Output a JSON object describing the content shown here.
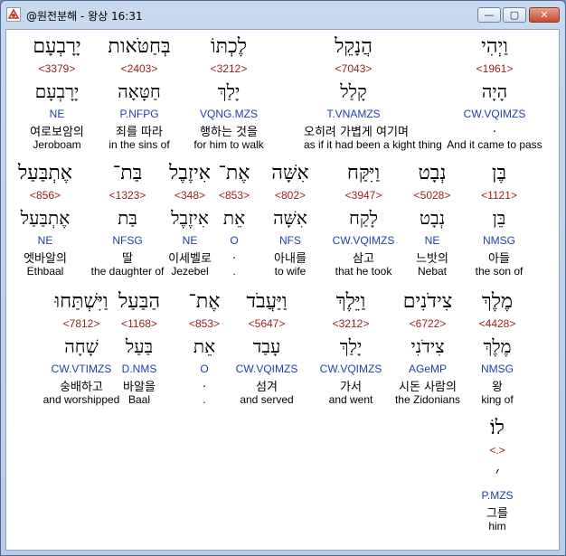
{
  "window": {
    "title": "@원전분해 - 왕상 16:31",
    "minimize": "—",
    "maximize": "▢",
    "close": "✕"
  },
  "rows": [
    {
      "words": [
        {
          "heb": "וַיְהִי",
          "strong": "<1961>",
          "lemma": "הָיָה",
          "morph": "CW.VQIMZS",
          "kor": ".",
          "eng": "And it came to pass"
        },
        {
          "heb": "הֲנָקֵל",
          "strong": "<7043>",
          "lemma": "קָלַל",
          "morph": "T.VNAMZS",
          "kor": "오히려 가볍게 여기며",
          "eng": "as if it had been a kight thing"
        },
        {
          "heb": "לֶכְתּוֹ",
          "strong": "<3212>",
          "lemma": "יָלַךְ",
          "morph": "VQNG.MZS",
          "kor": "행하는 것을",
          "eng": "for him to walk"
        },
        {
          "heb": "בְּחַטֹּאות",
          "strong": "<2403>",
          "lemma": "חַטָּאָה",
          "morph": "P.NFPG",
          "kor": "죄를 따라",
          "eng": "in the sins of"
        },
        {
          "heb": "יָרָבְעָם",
          "strong": "<3379>",
          "lemma": "יָרָבְעָם",
          "morph": "NE",
          "kor": "여로보암의",
          "eng": "Jeroboam"
        }
      ]
    },
    {
      "words": [
        {
          "heb": "בֶּן",
          "strong": "<1121>",
          "lemma": "בֵּן",
          "morph": "NMSG",
          "kor": "아들",
          "eng": "the son of"
        },
        {
          "heb": "נְבָט",
          "strong": "<5028>",
          "lemma": "נְבָט",
          "morph": "NE",
          "kor": "느밧의",
          "eng": "Nebat"
        },
        {
          "heb": "וַיִּקַּח",
          "strong": "<3947>",
          "lemma": "לָקַח",
          "morph": "CW.VQIMZS",
          "kor": "삼고",
          "eng": "that he took"
        },
        {
          "heb": "אִשָּׁה",
          "strong": "<802>",
          "lemma": "אִשָּׁה",
          "morph": "NFS",
          "kor": "아내를",
          "eng": "to wife"
        },
        {
          "heb": "אֶת־",
          "strong": "<853>",
          "lemma": "אֵת",
          "morph": "O",
          "kor": ".",
          "eng": "."
        },
        {
          "heb": "אִיזֶבֶל",
          "strong": "<348>",
          "lemma": "אִיזֶבֶל",
          "morph": "NE",
          "kor": "이세벨로",
          "eng": "Jezebel"
        },
        {
          "heb": "בַּת־",
          "strong": "<1323>",
          "lemma": "בַּת",
          "morph": "NFSG",
          "kor": "딸",
          "eng": "the daughter of"
        },
        {
          "heb": "אֶתְבַּעַל",
          "strong": "<856>",
          "lemma": "אֶתְבַּעַל",
          "morph": "NE",
          "kor": "엣바알의",
          "eng": "Ethbaal"
        }
      ]
    },
    {
      "words": [
        {
          "heb": "מֶלֶךְ",
          "strong": "<4428>",
          "lemma": "מֶלֶךְ",
          "morph": "NMSG",
          "kor": "왕",
          "eng": "king of"
        },
        {
          "heb": "צִידֹנִים",
          "strong": "<6722>",
          "lemma": "צִידֹנִי",
          "morph": "AGeMP",
          "kor": "시돈 사람의",
          "eng": "the Zidonians"
        },
        {
          "heb": "וַיֵּלֶךְ",
          "strong": "<3212>",
          "lemma": "יָלַךְ",
          "morph": "CW.VQIMZS",
          "kor": "가서",
          "eng": "and went"
        },
        {
          "heb": "וַיַּעֲבֹד",
          "strong": "<5647>",
          "lemma": "עָבַד",
          "morph": "CW.VQIMZS",
          "kor": "섬겨",
          "eng": "and served"
        },
        {
          "heb": "אֶת־",
          "strong": "<853>",
          "lemma": "אֵת",
          "morph": "O",
          "kor": ".",
          "eng": "."
        },
        {
          "heb": "הַבַּעַל",
          "strong": "<1168>",
          "lemma": "בַּעַל",
          "morph": "D.NMS",
          "kor": "바알을",
          "eng": "Baal"
        },
        {
          "heb": "וַיִּשְׁתַּחוּ",
          "strong": "<7812>",
          "lemma": "שָׁחָה",
          "morph": "CW.VTIMZS",
          "kor": "숭배하고",
          "eng": "and worshipped"
        }
      ]
    },
    {
      "words": [
        {
          "heb": "לוֹ׃",
          "strong": "<.>",
          "lemma": "׳",
          "morph": "P.MZS",
          "kor": "그를",
          "eng": "him"
        }
      ]
    }
  ]
}
